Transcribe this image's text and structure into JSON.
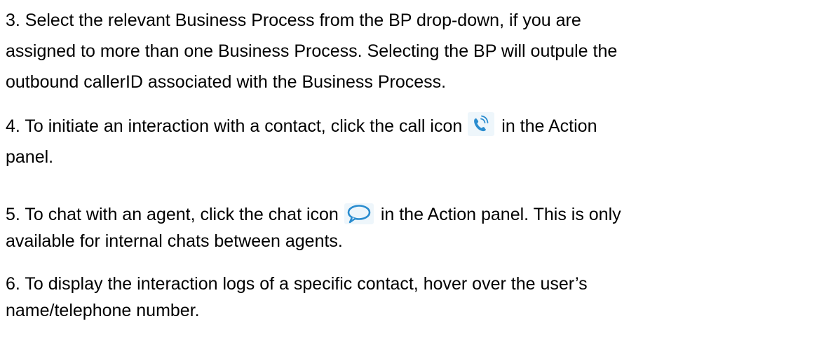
{
  "paragraphs": {
    "p3": {
      "line1": "3. Select the relevant Business Process from the BP drop-down, if you are",
      "line2": "assigned to more than one Business Process.  Selecting the BP will outpule the",
      "line3": "outbound callerID associated with the Business Process."
    },
    "p4": {
      "before_icon": "4. To initiate an interaction with a contact, click the call icon",
      "after_icon": "in the Action",
      "line2": "panel.",
      "icon": "phone-call-icon"
    },
    "p5": {
      "before_icon": "5. To chat with an agent, click the chat icon",
      "after_icon": "in the Action panel. This is only",
      "line2": "available for internal chats between agents.",
      "icon": "chat-bubble-icon"
    },
    "p6": {
      "line1": "6. To display the interaction logs of a specific contact, hover over the user’s",
      "line2": "name/telephone number."
    }
  },
  "colors": {
    "text": "#000000",
    "icon_tile": "#eef6fb",
    "icon_blue": "#2a8ccf"
  }
}
